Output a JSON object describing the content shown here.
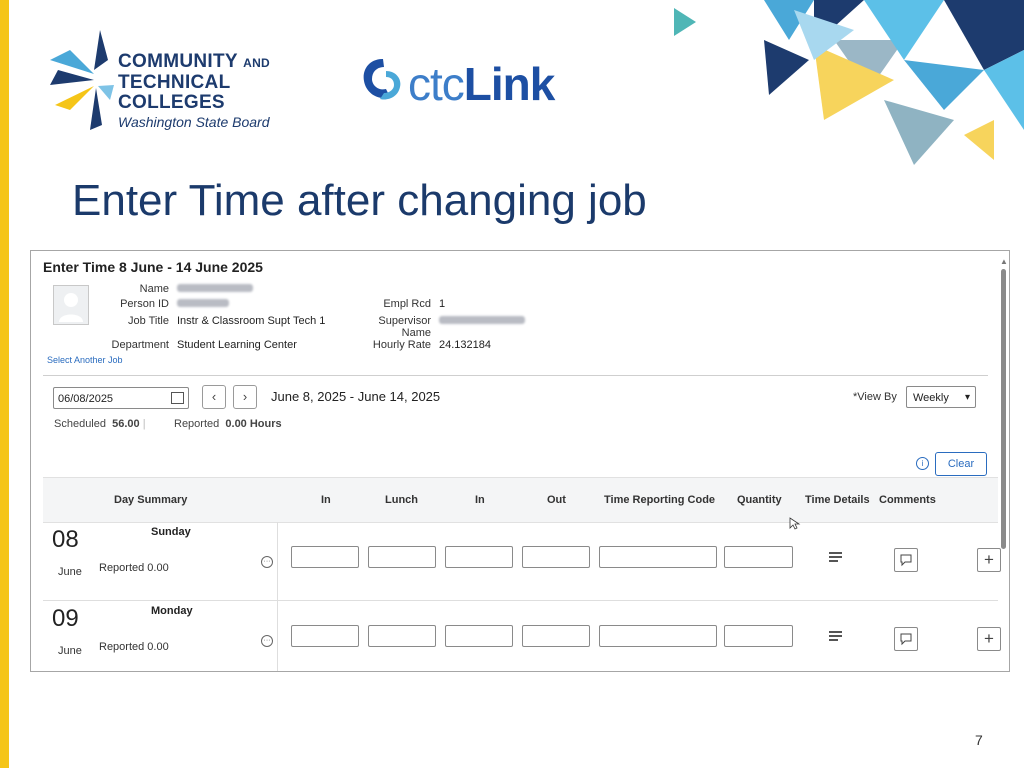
{
  "slide": {
    "title": "Enter Time after changing job",
    "page_number": "7"
  },
  "logos": {
    "board": {
      "line1": "COMMUNITY",
      "line1_small": "AND",
      "line2": "TECHNICAL COLLEGES",
      "line3": "Washington State Board"
    },
    "ctclink": {
      "thin": "ctc",
      "bold": "Link"
    }
  },
  "panel": {
    "title": "Enter Time 8 June - 14 June 2025",
    "labels": {
      "name": "Name",
      "person_id": "Person ID",
      "job_title": "Job Title",
      "department": "Department",
      "empl_rcd": "Empl Rcd",
      "supervisor": "Supervisor",
      "supervisor_name": "Name",
      "hourly_rate": "Hourly Rate"
    },
    "values": {
      "job_title": "Instr & Classroom Supt Tech 1",
      "department": "Student Learning Center",
      "empl_rcd": "1",
      "hourly_rate": "24.132184"
    },
    "select_another_job": "Select Another Job"
  },
  "controls": {
    "date_value": "06/08/2025",
    "prev_arrow": "‹",
    "next_arrow": "›",
    "range": "June 8, 2025 - June 14, 2025",
    "view_by_label": "*View By",
    "view_by_value": "Weekly",
    "scheduled_label": "Scheduled",
    "scheduled_value": "56.00",
    "reported_label": "Reported",
    "reported_value": "0.00 Hours",
    "clear": "Clear"
  },
  "grid": {
    "headers": [
      "Day Summary",
      "In",
      "Lunch",
      "In",
      "Out",
      "Time Reporting Code",
      "Quantity",
      "Time Details",
      "Comments"
    ],
    "rows": [
      {
        "day": "08",
        "month": "June",
        "weekday": "Sunday",
        "reported": "Reported 0.00"
      },
      {
        "day": "09",
        "month": "June",
        "weekday": "Monday",
        "reported": "Reported 0.00"
      }
    ]
  },
  "colors": {
    "title_blue": "#1b3a6b",
    "accent_yellow": "#f5c518",
    "link_blue": "#2a6cbf"
  }
}
